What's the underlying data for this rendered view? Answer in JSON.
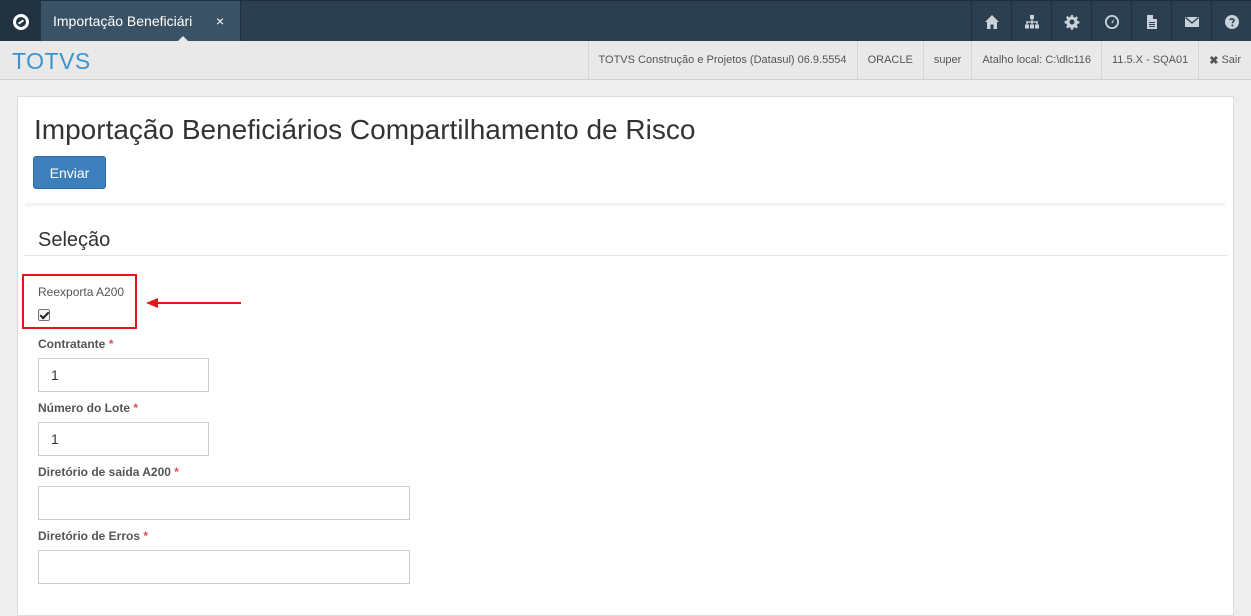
{
  "topbar": {
    "tab_label": "Importação Beneficiári",
    "tab_close": "×",
    "icons": [
      "home-icon",
      "sitemap-icon",
      "gear-icon",
      "dashboard-icon",
      "document-icon",
      "mail-icon",
      "help-icon"
    ]
  },
  "header": {
    "brand": "TOTVS",
    "product": "TOTVS Construção e Projetos (Datasul) 06.9.5554",
    "database": "ORACLE",
    "user": "super",
    "shortcut": "Atalho local: C:\\dlc116",
    "version": "11.5.X - SQA01",
    "logout_icon": "✖",
    "logout": "Sair"
  },
  "page": {
    "title": "Importação Beneficiários Compartilhamento de Risco",
    "send_button": "Enviar",
    "section_title": "Seleção"
  },
  "form": {
    "reexport": {
      "label": "Reexporta A200",
      "checked": true
    },
    "required_mark": "*",
    "contratante": {
      "label": "Contratante",
      "value": "1"
    },
    "lote": {
      "label": "Número do Lote",
      "value": "1"
    },
    "output_dir": {
      "label": "Diretório de saida A200",
      "value": ""
    },
    "error_dir": {
      "label": "Diretório de Erros",
      "value": ""
    }
  },
  "colors": {
    "topbar": "#2b3f50",
    "brand": "#3d93c9",
    "primary_button": "#3d7fbd",
    "highlight": "#e01818"
  }
}
